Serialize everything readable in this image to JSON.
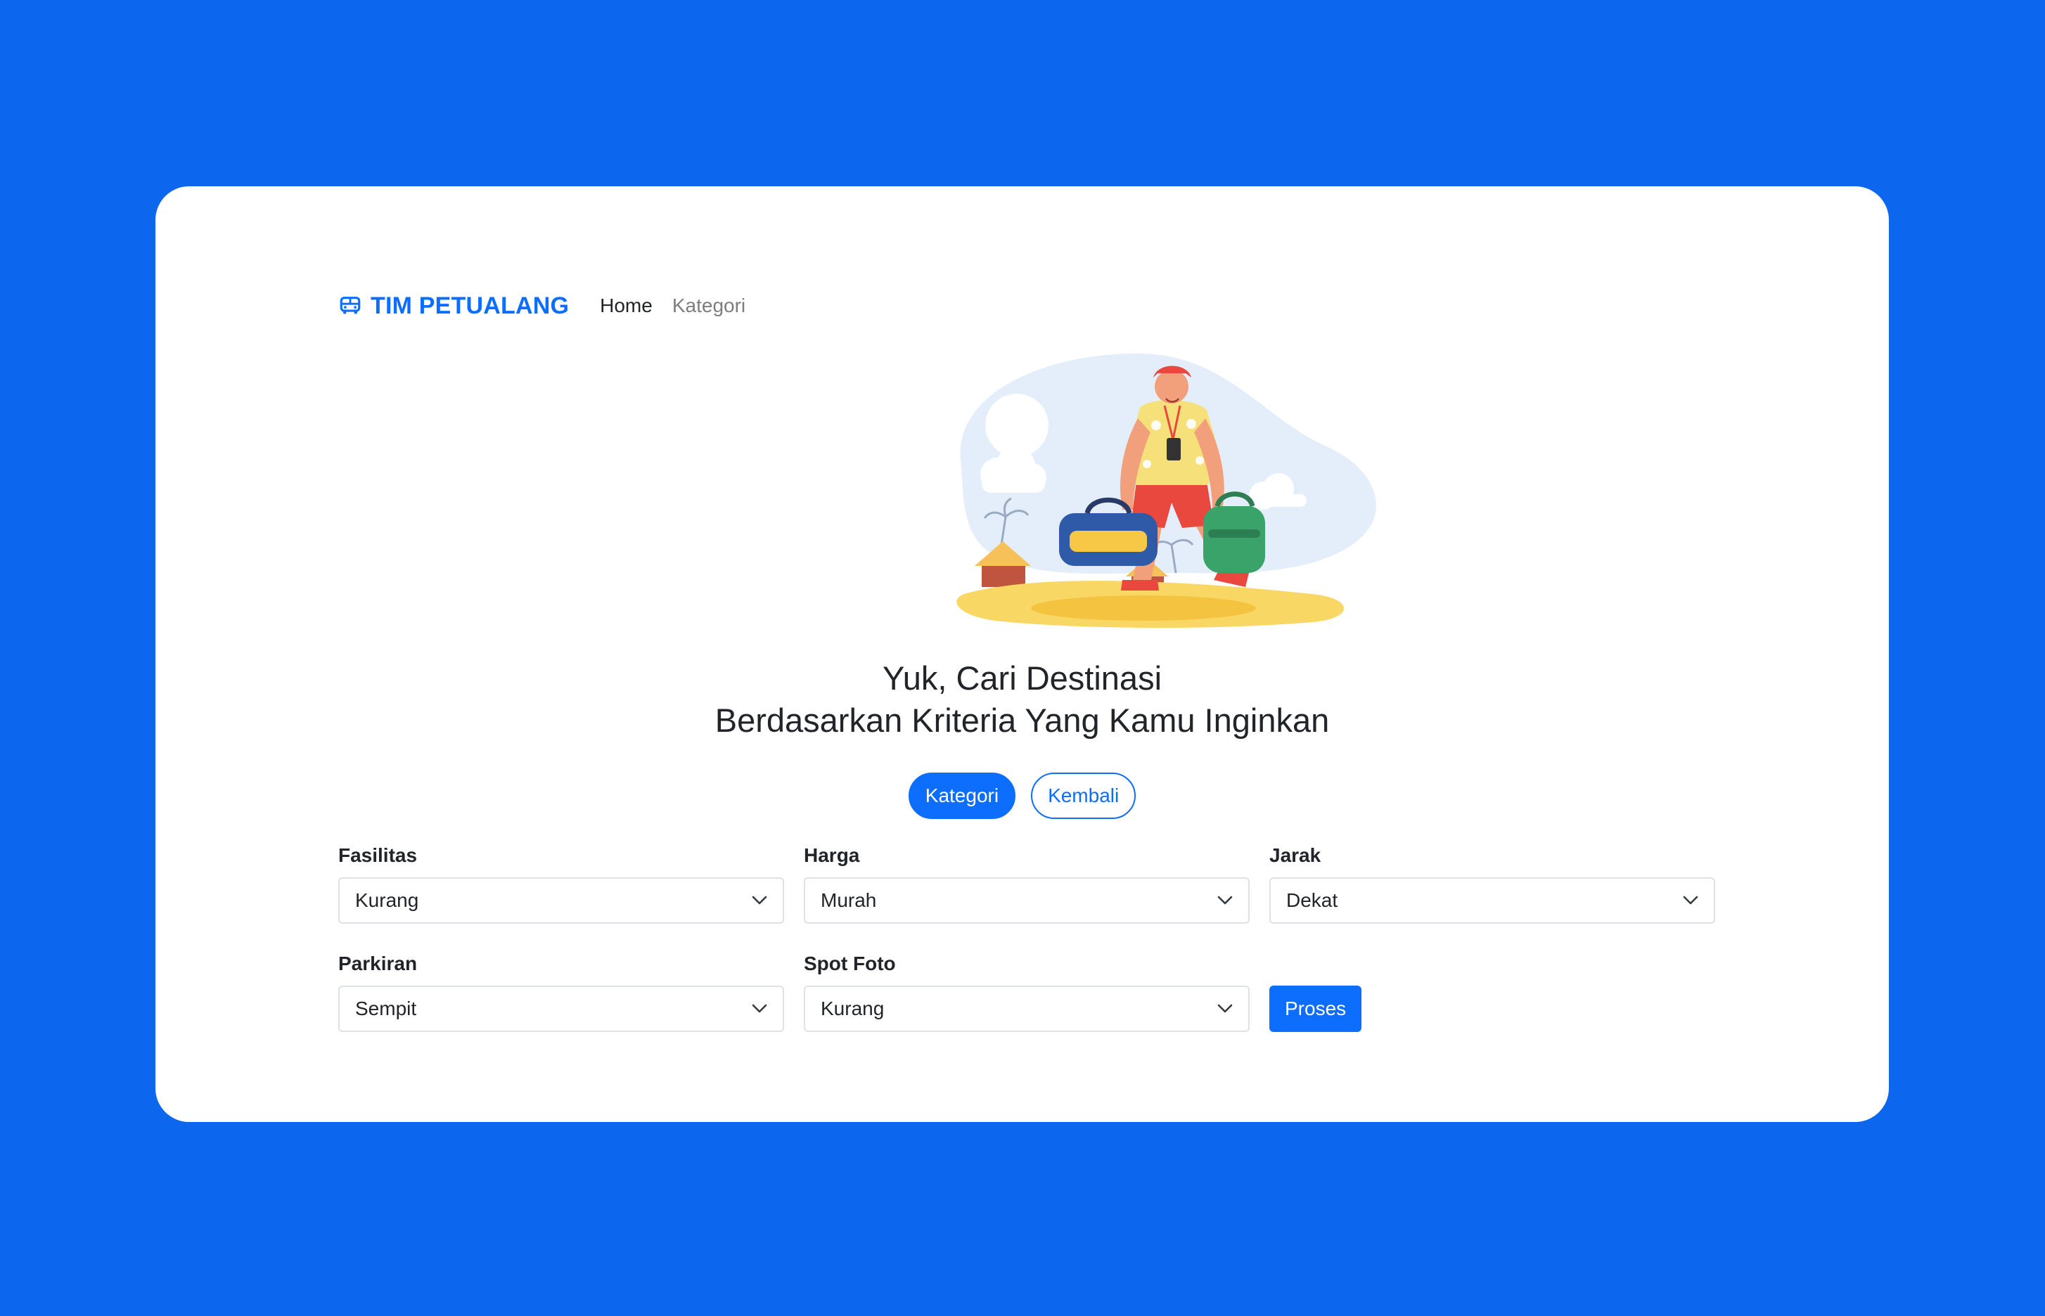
{
  "colors": {
    "background": "#0d66ee",
    "primary": "#0d6efd",
    "text": "#212529",
    "muted": "#7d7d7d"
  },
  "navbar": {
    "brand_icon": "bus-icon",
    "brand": "TIM PETUALANG",
    "links": [
      {
        "label": "Home",
        "active": true
      },
      {
        "label": "Kategori",
        "active": false
      }
    ]
  },
  "hero": {
    "illustration": "traveler-with-bags-beach-illustration"
  },
  "headline": {
    "line1": "Yuk, Cari Destinasi",
    "line2": "Berdasarkan Kriteria Yang Kamu Inginkan"
  },
  "actions": {
    "kategori": "Kategori",
    "kembali": "Kembali"
  },
  "form": {
    "fasilitas": {
      "label": "Fasilitas",
      "value": "Kurang"
    },
    "harga": {
      "label": "Harga",
      "value": "Murah"
    },
    "jarak": {
      "label": "Jarak",
      "value": "Dekat"
    },
    "parkiran": {
      "label": "Parkiran",
      "value": "Sempit"
    },
    "spot_foto": {
      "label": "Spot Foto",
      "value": "Kurang"
    },
    "submit": "Proses"
  }
}
